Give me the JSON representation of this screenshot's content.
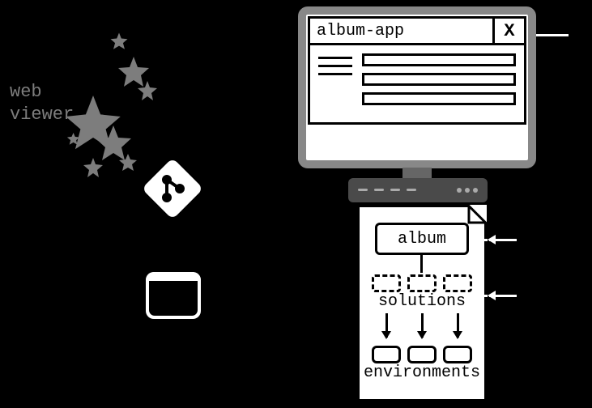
{
  "left": {
    "web_viewer_label": "web\nviewer",
    "icons": {
      "stars": "stars-cluster-icon",
      "git": "git-icon",
      "terminal": "terminal-icon"
    }
  },
  "monitor": {
    "app_title": "album-app",
    "close_label": "X"
  },
  "tower": {
    "album_label": "album",
    "solutions_label": "solutions",
    "environments_label": "environments"
  }
}
